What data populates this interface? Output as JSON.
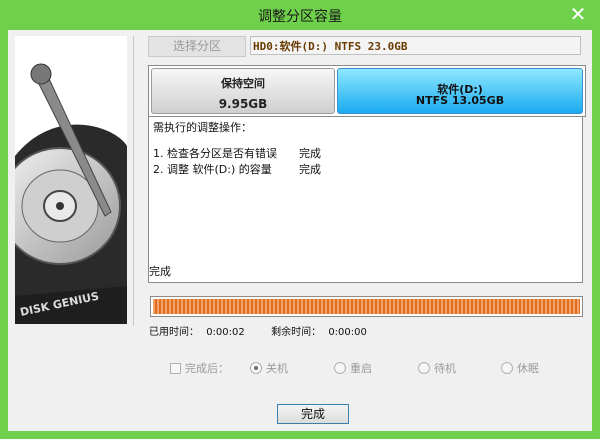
{
  "window": {
    "title": "调整分区容量",
    "close_glyph": "✕"
  },
  "toolbar": {
    "select_partition_label": "选择分区",
    "partition_info": "HD0:软件(D:) NTFS 23.0GB"
  },
  "partitions": [
    {
      "label": "保持空间",
      "size": "9.95GB"
    },
    {
      "label": "软件(D:)",
      "size": "NTFS 13.05GB"
    }
  ],
  "log": {
    "header": "需执行的调整操作：",
    "items": [
      {
        "step": "1. 检查各分区是否有错误",
        "status": "完成"
      },
      {
        "step": "2. 调整 软件(D:) 的容量",
        "status": "完成"
      }
    ]
  },
  "status": {
    "text": "完成",
    "progress": 1.0
  },
  "times": {
    "elapsed_label": "已用时间：",
    "elapsed": "0:00:02",
    "remaining_label": "剩余时间：",
    "remaining": "0:00:00"
  },
  "after": {
    "label": "完成后：",
    "options": [
      "关机",
      "重启",
      "待机",
      "休眠"
    ],
    "selected": "关机"
  },
  "buttons": {
    "done": "完成"
  },
  "graphic": {
    "brand_text": "DISK GENIUS"
  },
  "colors": {
    "titlebar": "#6fd14b",
    "selected_partition": "#1aaaf0",
    "progress": "#e06c1c"
  },
  "icons": [
    "close-icon",
    "hard-disk-graphic"
  ]
}
